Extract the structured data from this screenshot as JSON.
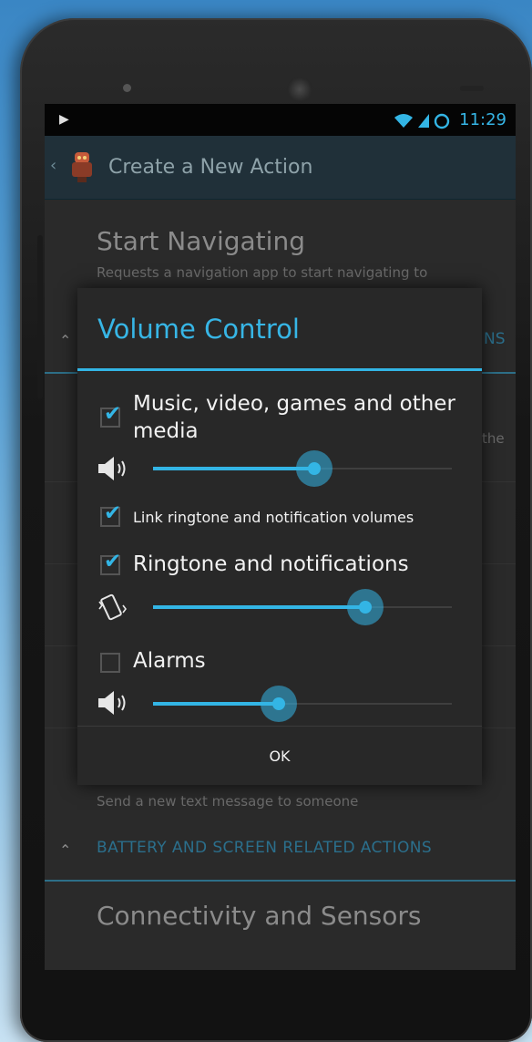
{
  "status_bar": {
    "time": "11:29",
    "play_icon": "play-icon",
    "signal_icons": [
      "wifi-icon",
      "signal-icon",
      "sync-icon"
    ]
  },
  "action_bar": {
    "title": "Create a New Action",
    "app_icon": "robot-icon"
  },
  "background_list": {
    "item_start_navigating": {
      "title": "Start Navigating",
      "subtitle": "Requests a navigation app to start navigating to"
    },
    "section_partial_right": "NS",
    "partial_right_text": "the",
    "send_sms_subtitle": "Send a new text message to someone",
    "section_battery": "BATTERY AND SCREEN RELATED ACTIONS",
    "item_connectivity": "Connectivity and Sensors"
  },
  "dialog": {
    "title": "Volume Control",
    "media": {
      "label": "Music, video, games and other media",
      "checked": true,
      "icon": "speaker-icon",
      "level": 0.54
    },
    "link_ringtone": {
      "label": "Link ringtone and notification volumes",
      "checked": true
    },
    "ringtone": {
      "label": "Ringtone and notifications",
      "checked": true,
      "icon": "vibrate-icon",
      "level": 0.71
    },
    "alarms": {
      "label": "Alarms",
      "checked": false,
      "icon": "speaker-icon",
      "level": 0.42
    },
    "ok_label": "OK"
  },
  "colors": {
    "accent": "#33b5e5",
    "dialog_bg": "#282828",
    "action_bar_bg": "#203039"
  }
}
